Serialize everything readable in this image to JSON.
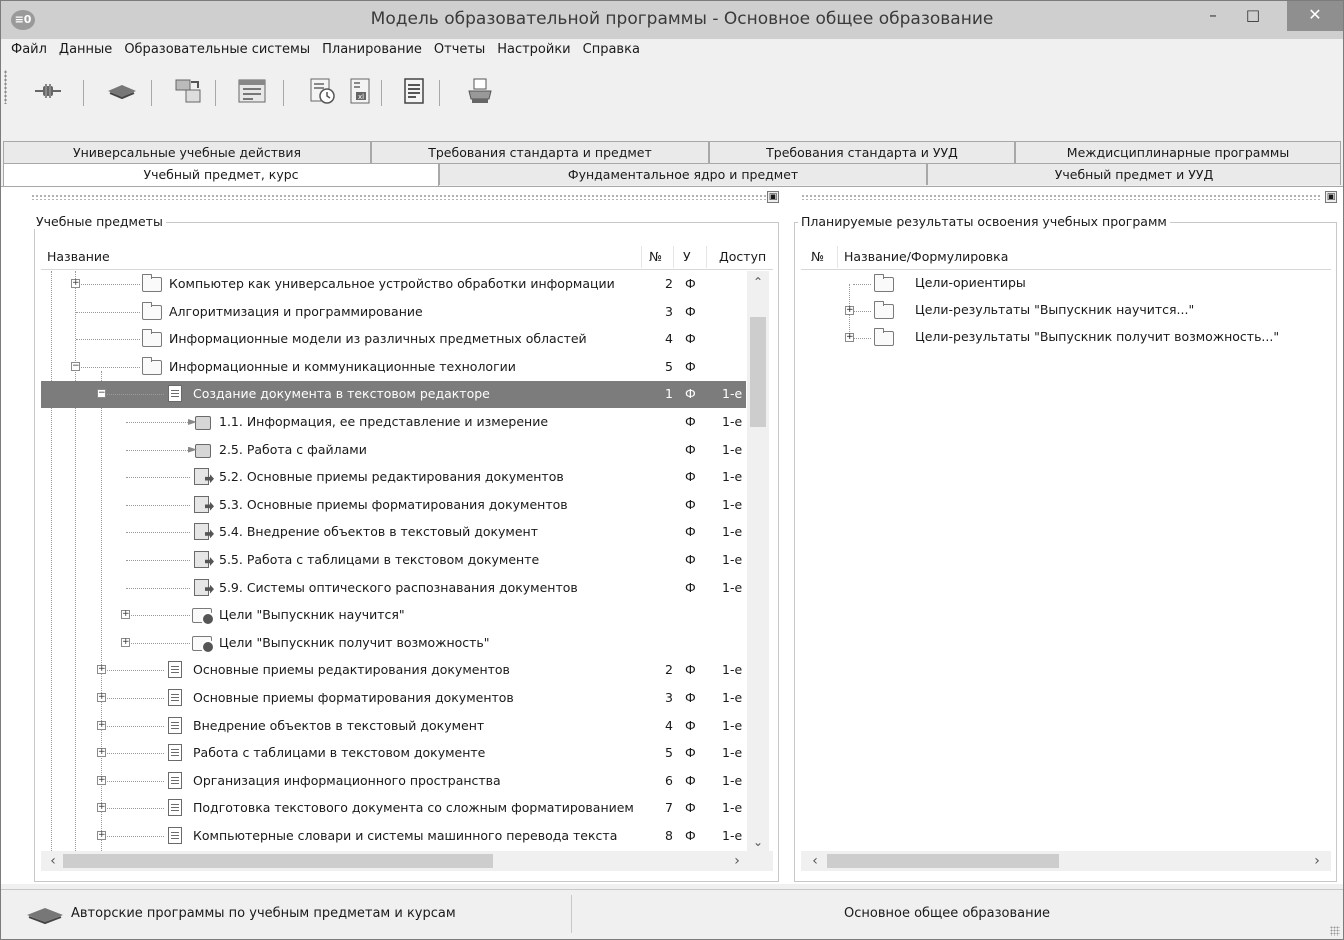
{
  "window": {
    "title": "Модель образовательной программы - Основное общее образование",
    "app_icon": "≡0"
  },
  "menu": [
    "Файл",
    "Данные",
    "Образовательные системы",
    "Планирование",
    "Отчеты",
    "Настройки",
    "Справка"
  ],
  "tabs_row1": [
    "Универсальные учебные действия",
    "Требования стандарта и предмет",
    "Требования стандарта и УУД",
    "Междисциплинарные программы"
  ],
  "tabs_row2": [
    "Учебный предмет, курс",
    "Фундаментальное ядро и предмет",
    "Учебный предмет и УУД"
  ],
  "left_panel": {
    "title": "Учебные предметы",
    "columns": {
      "name": "Название",
      "num": "№",
      "u": "У",
      "access": "Доступ"
    },
    "rows": [
      {
        "level": 1,
        "icon": "folder-icon",
        "expander": "+",
        "label": "Компьютер как универсальное устройство обработки информации",
        "num": "2",
        "u": "Ф",
        "access": ""
      },
      {
        "level": 1,
        "icon": "folder-icon",
        "expander": "",
        "label": "Алгоритмизация и программирование",
        "num": "3",
        "u": "Ф",
        "access": ""
      },
      {
        "level": 1,
        "icon": "folder-icon",
        "expander": "",
        "label": "Информационные модели из различных предметных областей",
        "num": "4",
        "u": "Ф",
        "access": ""
      },
      {
        "level": 1,
        "icon": "folder-icon",
        "expander": "−",
        "label": "Информационные и коммуникационные технологии",
        "num": "5",
        "u": "Ф",
        "access": ""
      },
      {
        "level": 2,
        "icon": "document-icon",
        "expander": "−",
        "label": "Создание документа в текстовом редакторе",
        "num": "1",
        "u": "Ф",
        "access": "1-е",
        "selected": true
      },
      {
        "level": 3,
        "icon": "stack-icon",
        "expander": "",
        "label": "1.1. Информация, ее представление и измерение",
        "num": "",
        "u": "Ф",
        "access": "1-е"
      },
      {
        "level": 3,
        "icon": "stack-icon",
        "expander": "",
        "label": "2.5. Работа с файлами",
        "num": "",
        "u": "Ф",
        "access": "1-е"
      },
      {
        "level": 3,
        "icon": "pages-arrow-icon",
        "expander": "",
        "label": "5.2. Основные приемы редактирования документов",
        "num": "",
        "u": "Ф",
        "access": "1-е"
      },
      {
        "level": 3,
        "icon": "pages-arrow-icon",
        "expander": "",
        "label": "5.3. Основные приемы форматирования документов",
        "num": "",
        "u": "Ф",
        "access": "1-е"
      },
      {
        "level": 3,
        "icon": "pages-arrow-icon",
        "expander": "",
        "label": "5.4. Внедрение объектов в текстовый документ",
        "num": "",
        "u": "Ф",
        "access": "1-е"
      },
      {
        "level": 3,
        "icon": "pages-arrow-icon",
        "expander": "",
        "label": "5.5. Работа с таблицами в текстовом документе",
        "num": "",
        "u": "Ф",
        "access": "1-е"
      },
      {
        "level": 3,
        "icon": "pages-arrow-icon",
        "expander": "",
        "label": "5.9. Системы оптического распознавания документов",
        "num": "",
        "u": "Ф",
        "access": "1-е"
      },
      {
        "level": 3,
        "icon": "goal-folder-icon",
        "expander": "+",
        "label": "Цели \"Выпускник научится\"",
        "num": "",
        "u": "",
        "access": ""
      },
      {
        "level": 3,
        "icon": "goal-folder-icon",
        "expander": "+",
        "label": "Цели \"Выпускник получит возможность\"",
        "num": "",
        "u": "",
        "access": ""
      },
      {
        "level": 2,
        "icon": "document-icon",
        "expander": "+",
        "label": "Основные приемы редактирования документов",
        "num": "2",
        "u": "Ф",
        "access": "1-е"
      },
      {
        "level": 2,
        "icon": "document-icon",
        "expander": "+",
        "label": "Основные приемы форматирования документов",
        "num": "3",
        "u": "Ф",
        "access": "1-е"
      },
      {
        "level": 2,
        "icon": "document-icon",
        "expander": "+",
        "label": "Внедрение объектов в текстовый документ",
        "num": "4",
        "u": "Ф",
        "access": "1-е"
      },
      {
        "level": 2,
        "icon": "document-icon",
        "expander": "+",
        "label": "Работа с таблицами в текстовом документе",
        "num": "5",
        "u": "Ф",
        "access": "1-е"
      },
      {
        "level": 2,
        "icon": "document-icon",
        "expander": "+",
        "label": "Организация информационного пространства",
        "num": "6",
        "u": "Ф",
        "access": "1-е"
      },
      {
        "level": 2,
        "icon": "document-icon",
        "expander": "+",
        "label": "Подготовка текстового документа со сложным форматированием",
        "num": "7",
        "u": "Ф",
        "access": "1-е"
      },
      {
        "level": 2,
        "icon": "document-icon",
        "expander": "+",
        "label": "Компьютерные словари и системы машинного перевода текста",
        "num": "8",
        "u": "Ф",
        "access": "1-е"
      }
    ]
  },
  "right_panel": {
    "title": "Планируемые результаты освоения учебных программ",
    "columns": {
      "num": "№",
      "name": "Название/Формулировка"
    },
    "rows": [
      {
        "expander": "",
        "label": "Цели-ориентиры"
      },
      {
        "expander": "+",
        "label": "Цели-результаты \"Выпускник научится...\""
      },
      {
        "expander": "+",
        "label": "Цели-результаты \"Выпускник получит возможность...\""
      }
    ]
  },
  "statusbar": {
    "left": "Авторские программы по учебным предметам и курсам",
    "right": "Основное общее образование"
  },
  "colors": {
    "selection": "#7c7c7c",
    "titlebar": "#cfcfcf",
    "close_button": "#8f8f8f"
  }
}
